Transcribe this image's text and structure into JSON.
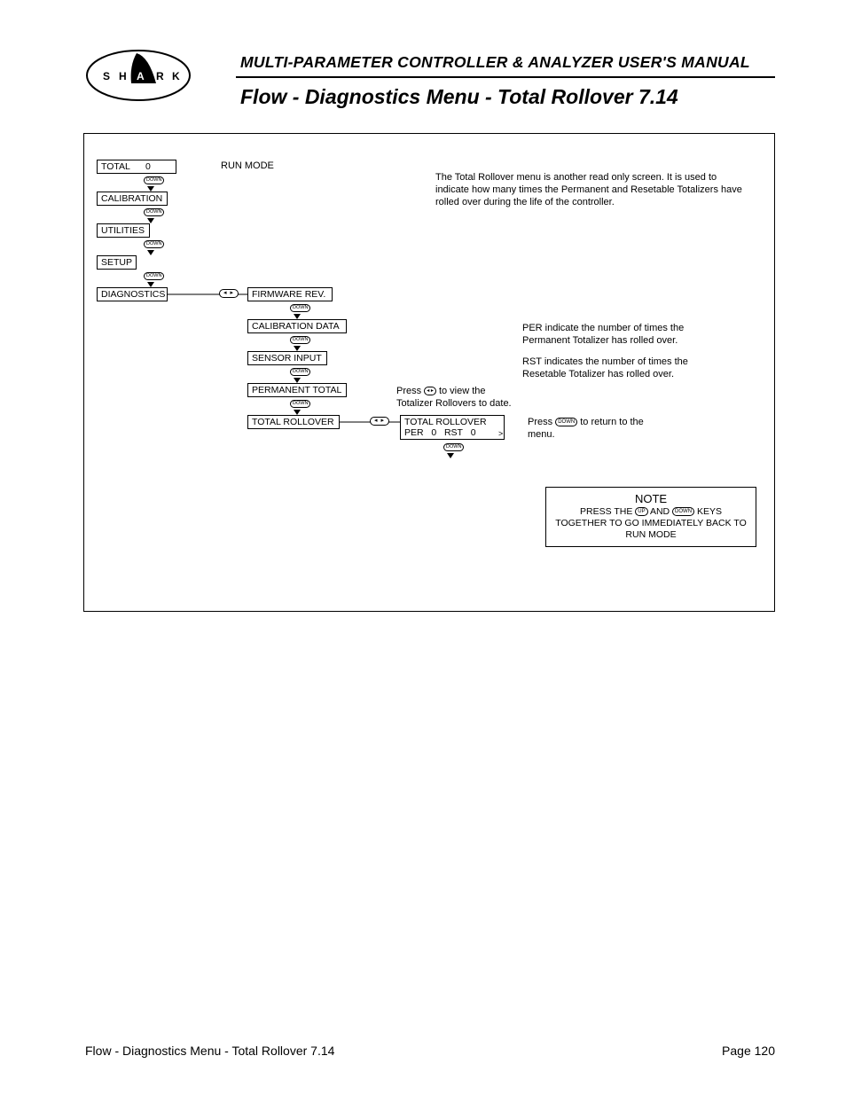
{
  "header": {
    "manual_title": "MULTI-PARAMETER CONTROLLER & ANALYZER USER'S MANUAL",
    "section_title": "Flow - Diagnostics Menu - Total Rollover 7.14",
    "logo_letters": [
      "S",
      "H",
      "A",
      "R",
      "K"
    ]
  },
  "menu": {
    "total": "TOTAL",
    "total_value": "0",
    "run_mode": "RUN MODE",
    "calibration": "CALIBRATION",
    "utilities": "UTILITIES",
    "setup": "SETUP",
    "diagnostics": "DIAGNOSTICS",
    "firmware_rev": "FIRMWARE REV.",
    "calibration_data": "CALIBRATION DATA",
    "sensor_input": "SENSOR INPUT",
    "permanent_total": "PERMANENT TOTAL",
    "total_rollover": "TOTAL ROLLOVER",
    "total_rollover2": "TOTAL ROLLOVER",
    "per_label": "PER",
    "per_value": "0",
    "rst_label": "RST",
    "rst_value": "0"
  },
  "buttons": {
    "down": "DOWN",
    "up": "UP"
  },
  "descriptions": {
    "intro": "The Total Rollover menu is another read only screen. It is used to indicate how many times the Permanent and Resetable Totalizers have rolled over during the life of the controller.",
    "per_desc": "PER indicate the number of times the Permanent Totalizer has rolled over.",
    "rst_desc": "RST indicates the number of times the Resetable Totalizer has rolled over.",
    "press_view_pre": "Press",
    "press_view_post": "to view the Totalizer Rollovers to date.",
    "press_return_pre": "Press",
    "press_return_post": "to return to the menu."
  },
  "note": {
    "title": "NOTE",
    "line1_pre": "PRESS THE",
    "line1_mid": "AND",
    "line1_post": "KEYS",
    "line2": "TOGETHER TO GO IMMEDIATELY BACK TO",
    "line3": "RUN MODE"
  },
  "footer": {
    "left": "Flow - Diagnostics Menu - Total Rollover 7.14",
    "right": "Page 120"
  }
}
